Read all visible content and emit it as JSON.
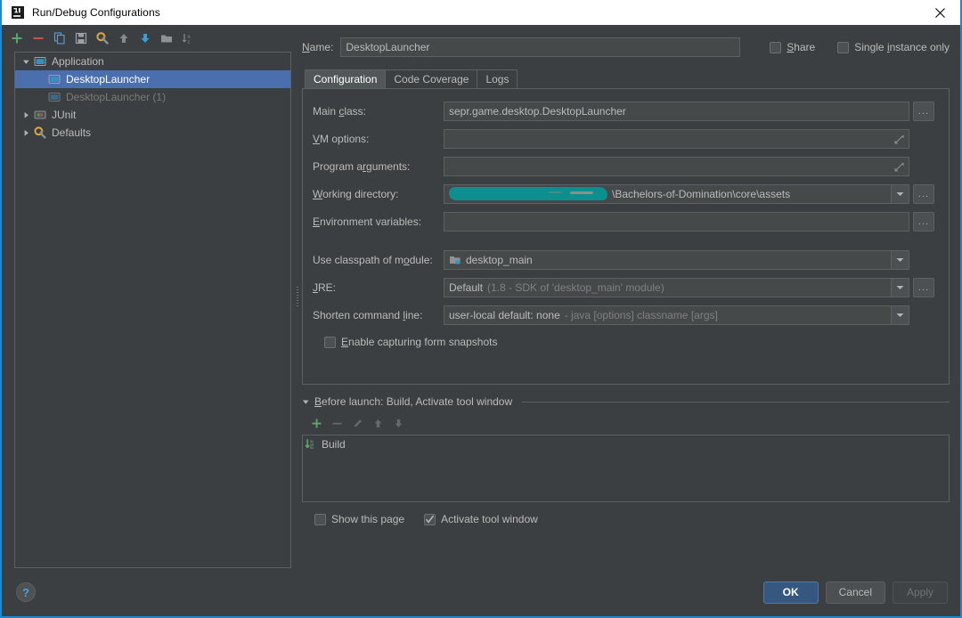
{
  "window": {
    "title": "Run/Debug Configurations",
    "logo_icon": "intellij-idea-logo",
    "close_icon": "close-icon",
    "accent_color": "#1a8ad4",
    "background_color": "#3c3f41"
  },
  "tree_toolbar": {
    "buttons": [
      {
        "name": "add-configuration-button",
        "icon": "plus-icon",
        "color": "#59a869",
        "tooltip": "Add New Configuration"
      },
      {
        "name": "remove-configuration-button",
        "icon": "minus-icon",
        "color": "#c75450",
        "tooltip": "Remove Configuration"
      },
      {
        "name": "copy-configuration-button",
        "icon": "copy-icon",
        "color": "#5f9dd6",
        "tooltip": "Copy Configuration"
      },
      {
        "name": "save-configuration-button",
        "icon": "save-floppy-icon",
        "color": "#9aa0a6",
        "tooltip": "Save Configuration"
      },
      {
        "name": "edit-defaults-button",
        "icon": "gear-wrench-icon",
        "color": "#d9a343",
        "tooltip": "Edit Defaults"
      },
      {
        "name": "move-up-button",
        "icon": "arrow-up-icon",
        "color": "#868a8c",
        "tooltip": "Move Up"
      },
      {
        "name": "move-down-button",
        "icon": "arrow-down-icon",
        "color": "#389fd6",
        "tooltip": "Move Down"
      },
      {
        "name": "create-folder-button",
        "icon": "folder-icon",
        "color": "#8e9295",
        "tooltip": "Create New Folder"
      },
      {
        "name": "sort-configurations-button",
        "icon": "sort-az-icon",
        "color": "#868a8c",
        "tooltip": "Sort Configurations"
      }
    ]
  },
  "tree": {
    "nodes": [
      {
        "label": "Application",
        "icon": "application-icon",
        "level": 0,
        "expanded": true,
        "selected": false,
        "muted": false,
        "has_twisty": true
      },
      {
        "label": "DesktopLauncher",
        "icon": "application-icon",
        "level": 1,
        "expanded": false,
        "selected": true,
        "muted": false,
        "has_twisty": false
      },
      {
        "label": "DesktopLauncher (1)",
        "icon": "application-icon",
        "level": 1,
        "expanded": false,
        "selected": false,
        "muted": true,
        "has_twisty": false
      },
      {
        "label": "JUnit",
        "icon": "junit-icon",
        "level": 0,
        "expanded": false,
        "selected": false,
        "muted": false,
        "has_twisty": true
      },
      {
        "label": "Defaults",
        "icon": "gear-wrench-icon",
        "level": 0,
        "expanded": false,
        "selected": false,
        "muted": false,
        "has_twisty": true
      }
    ]
  },
  "name_row": {
    "label": "Name:",
    "label_mnemonic": "N",
    "value": "DesktopLauncher",
    "share": {
      "label": "Share",
      "mnemonic": "S",
      "checked": false
    },
    "single_instance": {
      "label": "Single instance only",
      "mnemonic": "i",
      "checked": false
    }
  },
  "tabs": [
    {
      "label": "Configuration",
      "active": true
    },
    {
      "label": "Code Coverage",
      "active": false
    },
    {
      "label": "Logs",
      "active": false
    }
  ],
  "configuration": {
    "main_class": {
      "label_pre": "Main ",
      "label_mn": "c",
      "label_post": "lass:",
      "value": "sepr.game.desktop.DesktopLauncher",
      "browse_label": "..."
    },
    "vm_options": {
      "label_mn": "V",
      "label_post": "M options:",
      "value": "",
      "expand_icon": "expand-diagonal-icon"
    },
    "program_arguments": {
      "label_pre": "Program a",
      "label_mn": "r",
      "label_post": "guments:",
      "value": "",
      "expand_icon": "expand-diagonal-icon"
    },
    "working_directory": {
      "label_mn": "W",
      "label_post": "orking directory:",
      "redacted": true,
      "value_visible": "\\Bachelors-of-Domination\\core\\assets",
      "redaction_color": "#0d8f8f",
      "browse_label": "...",
      "dropdown_icon": "chevron-down-icon"
    },
    "environment_variables": {
      "label_mn": "E",
      "label_post": "nvironment variables:",
      "value": "",
      "browse_label": "..."
    },
    "use_classpath_of_module": {
      "label_pre": "Use classpath of m",
      "label_mn": "o",
      "label_post": "dule:",
      "value": "desktop_main",
      "icon": "module-icon",
      "dropdown_icon": "chevron-down-icon"
    },
    "jre": {
      "label_mn": "J",
      "label_post": "RE:",
      "value_bright": "Default",
      "value_dim": "(1.8 - SDK of 'desktop_main' module)",
      "dropdown_icon": "chevron-down-icon",
      "browse_label": "..."
    },
    "shorten_command_line": {
      "label_pre": "Shorten command ",
      "label_mn": "l",
      "label_post": "ine:",
      "value_bright": "user-local default: none",
      "value_dim": "- java [options] classname [args]",
      "dropdown_icon": "chevron-down-icon"
    },
    "enable_form_snapshots": {
      "label_mn": "E",
      "label_post": "nable capturing form snapshots",
      "checked": false
    }
  },
  "before_launch": {
    "title_mn": "B",
    "title_post": "efore launch: Build, Activate tool window",
    "expanded": true,
    "collapse_icon": "triangle-down-icon",
    "toolbar": [
      {
        "name": "add-before-launch-task-button",
        "icon": "plus-icon",
        "color": "#59a869",
        "enabled": true
      },
      {
        "name": "remove-before-launch-task-button",
        "icon": "minus-icon",
        "color": "#6b6f70",
        "enabled": false
      },
      {
        "name": "edit-before-launch-task-button",
        "icon": "pencil-icon",
        "color": "#6b6f70",
        "enabled": false
      },
      {
        "name": "move-task-up-button",
        "icon": "arrow-up-icon",
        "color": "#6b6f70",
        "enabled": false
      },
      {
        "name": "move-task-down-button",
        "icon": "arrow-down-icon",
        "color": "#6b6f70",
        "enabled": false
      }
    ],
    "tasks": [
      {
        "label": "Build",
        "icon": "build-compile-icon"
      }
    ],
    "show_this_page": {
      "label": "Show this page",
      "checked": false
    },
    "activate_tool_window": {
      "label": "Activate tool window",
      "checked": true
    }
  },
  "bottom_bar": {
    "help_icon": "help-question-icon",
    "buttons": [
      {
        "label": "OK",
        "name": "ok-button",
        "style": "primary",
        "enabled": true
      },
      {
        "label": "Cancel",
        "name": "cancel-button",
        "style": "normal",
        "enabled": true
      },
      {
        "label": "Apply",
        "name": "apply-button",
        "style": "disabled",
        "enabled": false
      }
    ]
  }
}
